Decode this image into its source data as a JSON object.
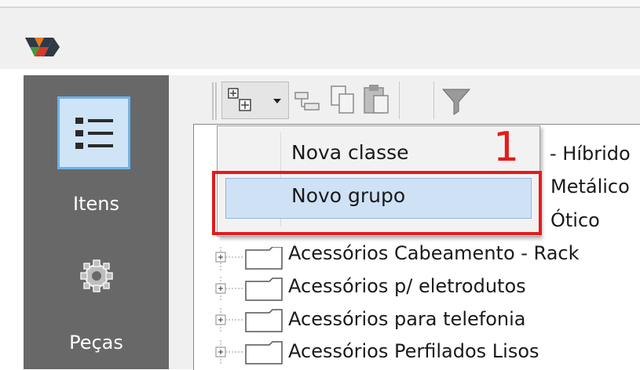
{
  "sidebar": {
    "items": [
      {
        "label": "Itens",
        "icon": "list-icon",
        "active": true
      },
      {
        "label": "Peças",
        "icon": "gear-icon",
        "active": false
      }
    ]
  },
  "toolbar": {
    "buttons": [
      {
        "icon": "add-class-icon",
        "has_dropdown": true
      },
      {
        "icon": "hierarchy-icon"
      },
      {
        "icon": "copy-icon"
      },
      {
        "icon": "paste-icon"
      },
      {
        "icon": "filter-icon"
      }
    ]
  },
  "dropdown_menu": {
    "items": [
      {
        "label": "Nova classe",
        "highlighted": false
      },
      {
        "label": "Novo grupo",
        "highlighted": true
      }
    ]
  },
  "tree": {
    "partial_right_labels": [
      "- Híbrido",
      "Metálico",
      "Ótico"
    ],
    "items": [
      {
        "label": "Acessórios Cabeamento - Rack"
      },
      {
        "label": "Acessórios p/ eletrodutos"
      },
      {
        "label": "Acessórios para telefonia"
      },
      {
        "label": "Acessórios Perfilados Lisos"
      }
    ]
  },
  "annotation": {
    "number": "1",
    "color": "#e31b1b"
  },
  "colors": {
    "rail": "#686868",
    "selection": "#cfe1f5",
    "active_tile": "#cfe4f7"
  }
}
